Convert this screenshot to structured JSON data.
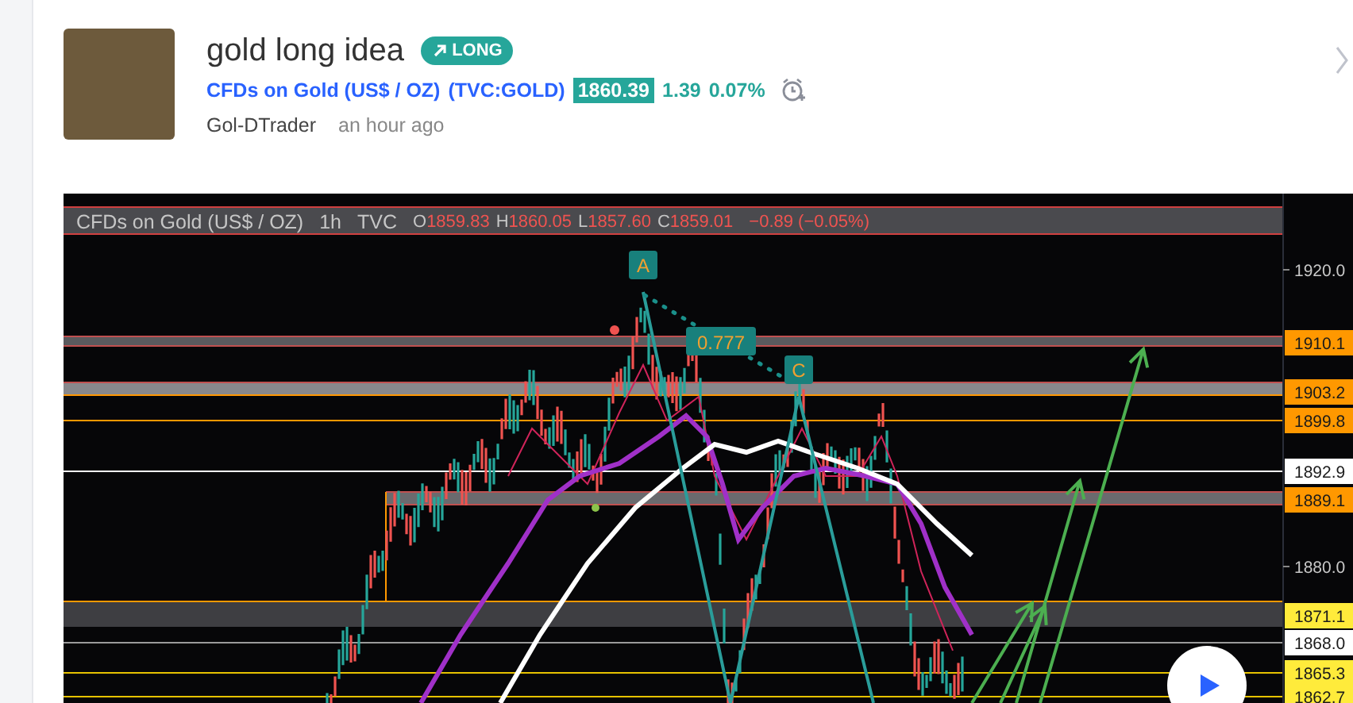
{
  "header": {
    "title": "gold long idea",
    "badge": {
      "label": "LONG",
      "kind": "long"
    },
    "symbol_name": "CFDs on Gold (US$ / OZ)",
    "symbol_code": "(TVC:GOLD)",
    "price": "1860.39",
    "change": "1.39",
    "change_percent": "0.07%",
    "author": "Gol-DTrader",
    "time": "an hour ago"
  },
  "chart": {
    "legend": {
      "symbol": "CFDs on Gold (US$ / OZ)",
      "interval": "1h",
      "exchange": "TVC",
      "change": "−0.89 (−0.05%)",
      "ohlc": [
        {
          "key": "O",
          "value": "1859.83"
        },
        {
          "key": "H",
          "value": "1860.05"
        },
        {
          "key": "L",
          "value": "1857.60"
        },
        {
          "key": "C",
          "value": "1859.01"
        }
      ]
    },
    "points": [
      {
        "label": "A"
      },
      {
        "label": "C"
      }
    ],
    "ratio": "0.777",
    "price_labels": [
      {
        "text": "1920.0",
        "kind": "plain"
      },
      {
        "text": "1910.1",
        "kind": "orange"
      },
      {
        "text": "1903.2",
        "kind": "orange"
      },
      {
        "text": "1899.8",
        "kind": "orange"
      },
      {
        "text": "1892.9",
        "kind": "white"
      },
      {
        "text": "1889.1",
        "kind": "orange"
      },
      {
        "text": "1880.0",
        "kind": "plain"
      },
      {
        "text": "1871.1",
        "kind": "yellow"
      },
      {
        "text": "1868.0",
        "kind": "white"
      },
      {
        "text": "1865.3",
        "kind": "yellow"
      },
      {
        "text": "1862.7",
        "kind": "yellow"
      }
    ]
  }
}
